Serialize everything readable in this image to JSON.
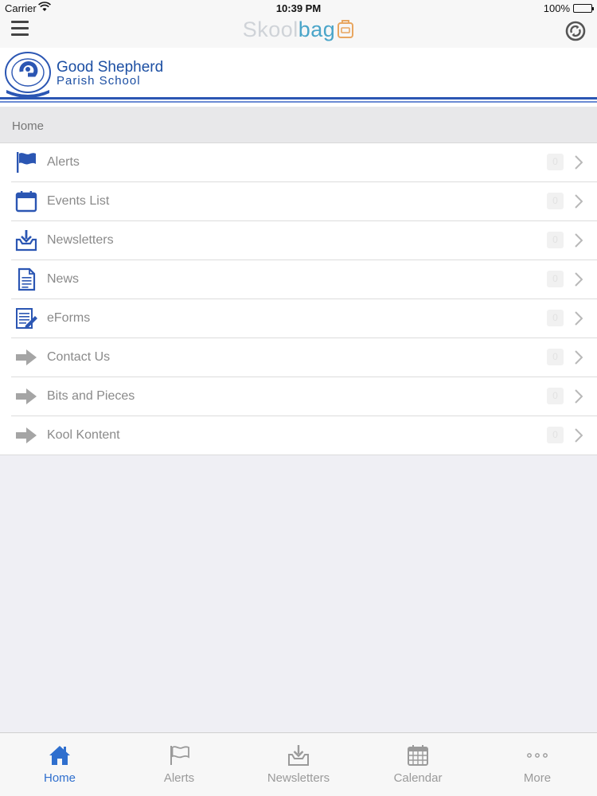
{
  "status_bar": {
    "carrier": "Carrier",
    "time": "10:39 PM",
    "battery": "100%"
  },
  "nav_bar": {
    "brand_part1": "Skool",
    "brand_part2": "bag",
    "menu_icon": "hamburger-icon",
    "sync_icon": "sync-icon"
  },
  "school": {
    "name_line1": "Good Shepherd",
    "name_line2": "Parish School"
  },
  "breadcrumb": "Home",
  "menu": {
    "items": [
      {
        "label": "Alerts",
        "icon": "flag-icon",
        "badge": "0"
      },
      {
        "label": "Events List",
        "icon": "calendar-icon",
        "badge": "0"
      },
      {
        "label": "Newsletters",
        "icon": "download-tray-icon",
        "badge": "0"
      },
      {
        "label": "News",
        "icon": "document-icon",
        "badge": "0"
      },
      {
        "label": "eForms",
        "icon": "form-pen-icon",
        "badge": "0"
      },
      {
        "label": "Contact Us",
        "icon": "arrow-right-icon",
        "badge": "0"
      },
      {
        "label": "Bits and Pieces",
        "icon": "arrow-right-icon",
        "badge": "0"
      },
      {
        "label": "Kool Kontent",
        "icon": "arrow-right-icon",
        "badge": "0"
      }
    ]
  },
  "tab_bar": {
    "tabs": [
      {
        "label": "Home",
        "icon": "home-icon",
        "active": true
      },
      {
        "label": "Alerts",
        "icon": "flag-icon",
        "active": false
      },
      {
        "label": "Newsletters",
        "icon": "download-tray-icon",
        "active": false
      },
      {
        "label": "Calendar",
        "icon": "calendar-icon",
        "active": false
      },
      {
        "label": "More",
        "icon": "more-dots-icon",
        "active": false
      }
    ]
  },
  "colors": {
    "accent": "#2f6fce",
    "school_blue": "#1c4fa3",
    "brand_blue": "#4aa5c9",
    "inactive_text": "#9a9a9a"
  }
}
